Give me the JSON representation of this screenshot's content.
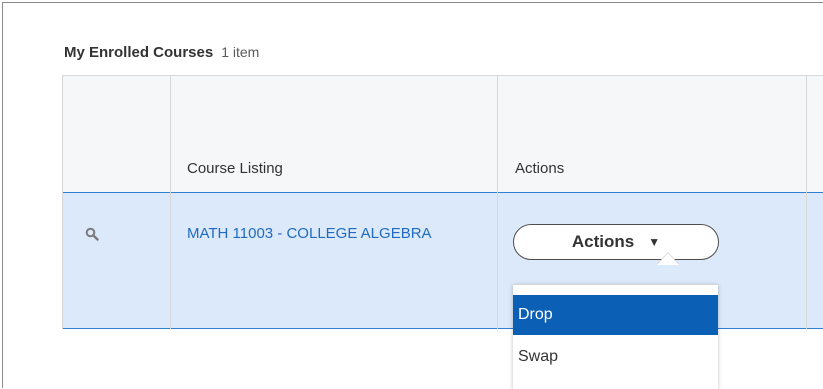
{
  "header": {
    "title": "My Enrolled Courses",
    "count": "1 item"
  },
  "table": {
    "columns": [
      "",
      "Course Listing",
      "Actions"
    ],
    "rows": [
      {
        "icon": "search-icon",
        "course": "MATH 11003 - COLLEGE ALGEBRA",
        "action_button": "Actions"
      }
    ]
  },
  "menu": {
    "items": [
      {
        "label": "Drop",
        "selected": true
      },
      {
        "label": "Swap",
        "selected": false
      }
    ]
  },
  "colors": {
    "row_selected_bg": "#dbe9fa",
    "row_selected_border": "#2f80d1",
    "link": "#1f6bc1",
    "menu_highlight": "#0b5fb4"
  }
}
